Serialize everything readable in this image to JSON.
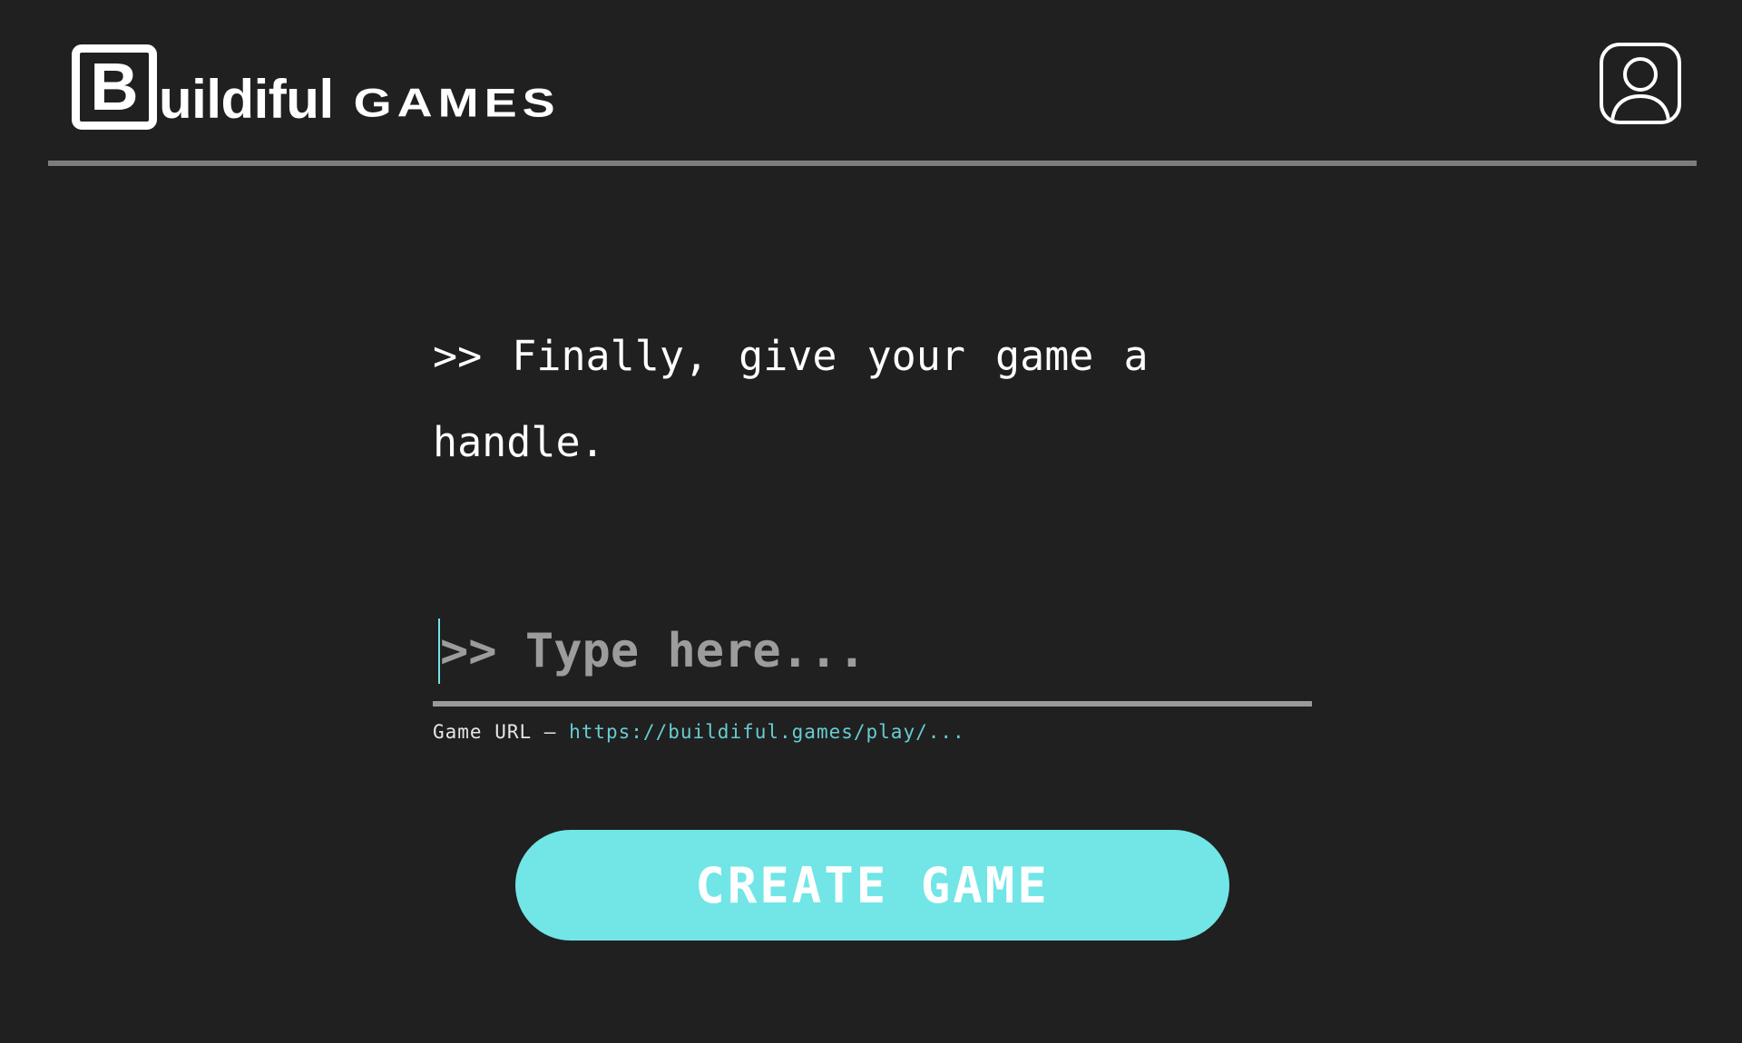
{
  "header": {
    "logo": {
      "box_letter": "B",
      "word": "uildiful",
      "suffix": "GAMES"
    },
    "profile_icon": "user-profile-icon"
  },
  "main": {
    "prompt_line1": ">> Finally, give your game a",
    "prompt_line2": "handle.",
    "handle_input": {
      "placeholder": ">> Type here...",
      "value": ""
    },
    "url_label": "Game URL – ",
    "url_value": "https://buildiful.games/play/...",
    "create_button_label": "CREATE GAME"
  },
  "colors": {
    "background": "#202020",
    "accent": "#72e5e6",
    "url_text": "#67cdd1",
    "divider": "#7d7d7d"
  }
}
